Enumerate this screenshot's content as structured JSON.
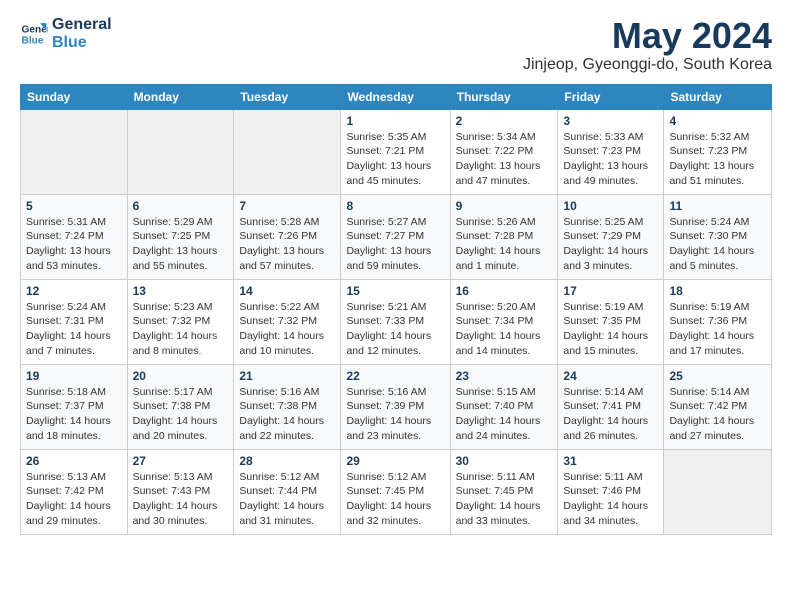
{
  "logo": {
    "line1": "General",
    "line2": "Blue"
  },
  "title": "May 2024",
  "location": "Jinjeop, Gyeonggi-do, South Korea",
  "days_header": [
    "Sunday",
    "Monday",
    "Tuesday",
    "Wednesday",
    "Thursday",
    "Friday",
    "Saturday"
  ],
  "weeks": [
    [
      {
        "num": "",
        "info": ""
      },
      {
        "num": "",
        "info": ""
      },
      {
        "num": "",
        "info": ""
      },
      {
        "num": "1",
        "info": "Sunrise: 5:35 AM\nSunset: 7:21 PM\nDaylight: 13 hours\nand 45 minutes."
      },
      {
        "num": "2",
        "info": "Sunrise: 5:34 AM\nSunset: 7:22 PM\nDaylight: 13 hours\nand 47 minutes."
      },
      {
        "num": "3",
        "info": "Sunrise: 5:33 AM\nSunset: 7:23 PM\nDaylight: 13 hours\nand 49 minutes."
      },
      {
        "num": "4",
        "info": "Sunrise: 5:32 AM\nSunset: 7:23 PM\nDaylight: 13 hours\nand 51 minutes."
      }
    ],
    [
      {
        "num": "5",
        "info": "Sunrise: 5:31 AM\nSunset: 7:24 PM\nDaylight: 13 hours\nand 53 minutes."
      },
      {
        "num": "6",
        "info": "Sunrise: 5:29 AM\nSunset: 7:25 PM\nDaylight: 13 hours\nand 55 minutes."
      },
      {
        "num": "7",
        "info": "Sunrise: 5:28 AM\nSunset: 7:26 PM\nDaylight: 13 hours\nand 57 minutes."
      },
      {
        "num": "8",
        "info": "Sunrise: 5:27 AM\nSunset: 7:27 PM\nDaylight: 13 hours\nand 59 minutes."
      },
      {
        "num": "9",
        "info": "Sunrise: 5:26 AM\nSunset: 7:28 PM\nDaylight: 14 hours\nand 1 minute."
      },
      {
        "num": "10",
        "info": "Sunrise: 5:25 AM\nSunset: 7:29 PM\nDaylight: 14 hours\nand 3 minutes."
      },
      {
        "num": "11",
        "info": "Sunrise: 5:24 AM\nSunset: 7:30 PM\nDaylight: 14 hours\nand 5 minutes."
      }
    ],
    [
      {
        "num": "12",
        "info": "Sunrise: 5:24 AM\nSunset: 7:31 PM\nDaylight: 14 hours\nand 7 minutes."
      },
      {
        "num": "13",
        "info": "Sunrise: 5:23 AM\nSunset: 7:32 PM\nDaylight: 14 hours\nand 8 minutes."
      },
      {
        "num": "14",
        "info": "Sunrise: 5:22 AM\nSunset: 7:32 PM\nDaylight: 14 hours\nand 10 minutes."
      },
      {
        "num": "15",
        "info": "Sunrise: 5:21 AM\nSunset: 7:33 PM\nDaylight: 14 hours\nand 12 minutes."
      },
      {
        "num": "16",
        "info": "Sunrise: 5:20 AM\nSunset: 7:34 PM\nDaylight: 14 hours\nand 14 minutes."
      },
      {
        "num": "17",
        "info": "Sunrise: 5:19 AM\nSunset: 7:35 PM\nDaylight: 14 hours\nand 15 minutes."
      },
      {
        "num": "18",
        "info": "Sunrise: 5:19 AM\nSunset: 7:36 PM\nDaylight: 14 hours\nand 17 minutes."
      }
    ],
    [
      {
        "num": "19",
        "info": "Sunrise: 5:18 AM\nSunset: 7:37 PM\nDaylight: 14 hours\nand 18 minutes."
      },
      {
        "num": "20",
        "info": "Sunrise: 5:17 AM\nSunset: 7:38 PM\nDaylight: 14 hours\nand 20 minutes."
      },
      {
        "num": "21",
        "info": "Sunrise: 5:16 AM\nSunset: 7:38 PM\nDaylight: 14 hours\nand 22 minutes."
      },
      {
        "num": "22",
        "info": "Sunrise: 5:16 AM\nSunset: 7:39 PM\nDaylight: 14 hours\nand 23 minutes."
      },
      {
        "num": "23",
        "info": "Sunrise: 5:15 AM\nSunset: 7:40 PM\nDaylight: 14 hours\nand 24 minutes."
      },
      {
        "num": "24",
        "info": "Sunrise: 5:14 AM\nSunset: 7:41 PM\nDaylight: 14 hours\nand 26 minutes."
      },
      {
        "num": "25",
        "info": "Sunrise: 5:14 AM\nSunset: 7:42 PM\nDaylight: 14 hours\nand 27 minutes."
      }
    ],
    [
      {
        "num": "26",
        "info": "Sunrise: 5:13 AM\nSunset: 7:42 PM\nDaylight: 14 hours\nand 29 minutes."
      },
      {
        "num": "27",
        "info": "Sunrise: 5:13 AM\nSunset: 7:43 PM\nDaylight: 14 hours\nand 30 minutes."
      },
      {
        "num": "28",
        "info": "Sunrise: 5:12 AM\nSunset: 7:44 PM\nDaylight: 14 hours\nand 31 minutes."
      },
      {
        "num": "29",
        "info": "Sunrise: 5:12 AM\nSunset: 7:45 PM\nDaylight: 14 hours\nand 32 minutes."
      },
      {
        "num": "30",
        "info": "Sunrise: 5:11 AM\nSunset: 7:45 PM\nDaylight: 14 hours\nand 33 minutes."
      },
      {
        "num": "31",
        "info": "Sunrise: 5:11 AM\nSunset: 7:46 PM\nDaylight: 14 hours\nand 34 minutes."
      },
      {
        "num": "",
        "info": ""
      }
    ]
  ]
}
